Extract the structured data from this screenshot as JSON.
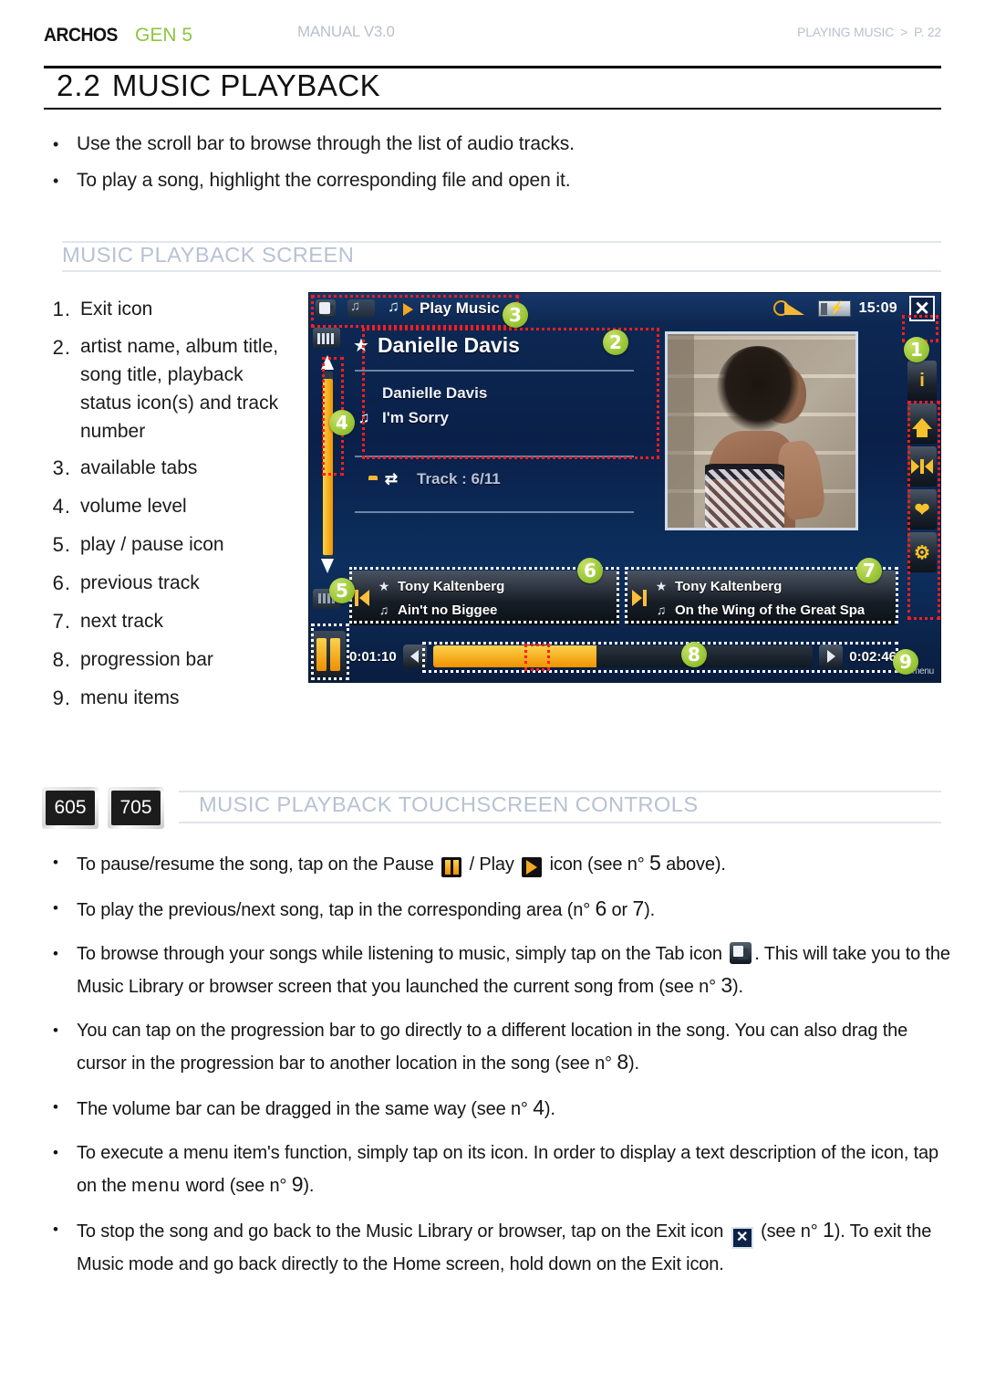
{
  "header": {
    "brand": "ARCHOS",
    "model": "GEN 5",
    "manual": "MANUAL V3.0",
    "section": "PLAYING MUSIC",
    "chevron": ">",
    "page": "P. 22"
  },
  "title": {
    "number": "2.2",
    "text": "MUSIC PLAYBACK"
  },
  "intro_bullets": [
    "Use the scroll bar to browse through the list of audio tracks.",
    "To play a song, highlight the corresponding file and open it."
  ],
  "section1": {
    "heading": "MUSIC PLAYBACK SCREEN"
  },
  "legend": [
    {
      "num": "1.",
      "text": "Exit icon"
    },
    {
      "num": "2.",
      "text": "artist name, album title, song title, playback status icon(s) and track number"
    },
    {
      "num": "3.",
      "text": "available tabs"
    },
    {
      "num": "4.",
      "text": "volume level"
    },
    {
      "num": "5.",
      "text": "play / pause icon"
    },
    {
      "num": "6.",
      "text": "previous track"
    },
    {
      "num": "7.",
      "text": "next track"
    },
    {
      "num": "8.",
      "text": "progression bar"
    },
    {
      "num": "9.",
      "text": "menu items"
    }
  ],
  "device": {
    "tab_label": "Play Music",
    "clock": "15:09",
    "artist_header": "Danielle Davis",
    "album": "Danielle Davis",
    "song": "I'm Sorry",
    "track": "Track : 6/11",
    "prev": {
      "artist": "Tony Kaltenberg",
      "song": "Ain't no Biggee"
    },
    "next": {
      "artist": "Tony Kaltenberg",
      "song": "On the Wing of the Great Spa"
    },
    "elapsed": "0:01:10",
    "duration": "0:02:46",
    "menu_word": "menu",
    "callout_numbers": [
      "1",
      "2",
      "3",
      "4",
      "5",
      "6",
      "7",
      "8",
      "9"
    ],
    "accent_orange": "#f39200",
    "screen_blue": "#0b2145",
    "callout_red": "#ff1d1d",
    "callout_green": "#9dc93a"
  },
  "section2": {
    "badge_605": "605",
    "badge_705": "705",
    "heading": "MUSIC PLAYBACK TOUCHSCREEN CONTROLS"
  },
  "controls_bullets": {
    "b1_a": "To pause/resume the song, tap on the Pause",
    "b1_b": "/ Play",
    "b1_c": "icon (see n°",
    "b1_n": "5",
    "b1_d": "above).",
    "b2_a": "To play the previous/next song, tap in the corresponding area (n°",
    "b2_n1": "6",
    "b2_b": "or",
    "b2_n2": "7",
    "b2_c": ").",
    "b3_a": "To browse through your songs while listening to music, simply tap on the Tab icon",
    "b3_b": ". This will take you to the Music Library or browser screen that you launched the current song from (see n°",
    "b3_n": "3",
    "b3_c": ").",
    "b4": "You can tap on the progression bar to go directly to a different location in the song. You can also drag the cursor in the progression bar to another location in the song (see n°",
    "b4_n": "8",
    "b4_c": ").",
    "b5": "The volume bar can be dragged in the same way (see n°",
    "b5_n": "4",
    "b5_c": ").",
    "b6_a": "To execute a menu item's function, simply tap on its icon. In order to display a text description of the icon, tap on the",
    "b6_menu": "menu",
    "b6_b": "word (see n°",
    "b6_n": "9",
    "b6_c": ").",
    "b7_a": "To stop the song and go back to the Music Library or browser, tap on the Exit icon",
    "b7_b": "(see n°",
    "b7_n": "1",
    "b7_c": "). To exit the Music mode and go back directly to the Home screen, hold down on the Exit icon."
  },
  "bullet_char": "•"
}
